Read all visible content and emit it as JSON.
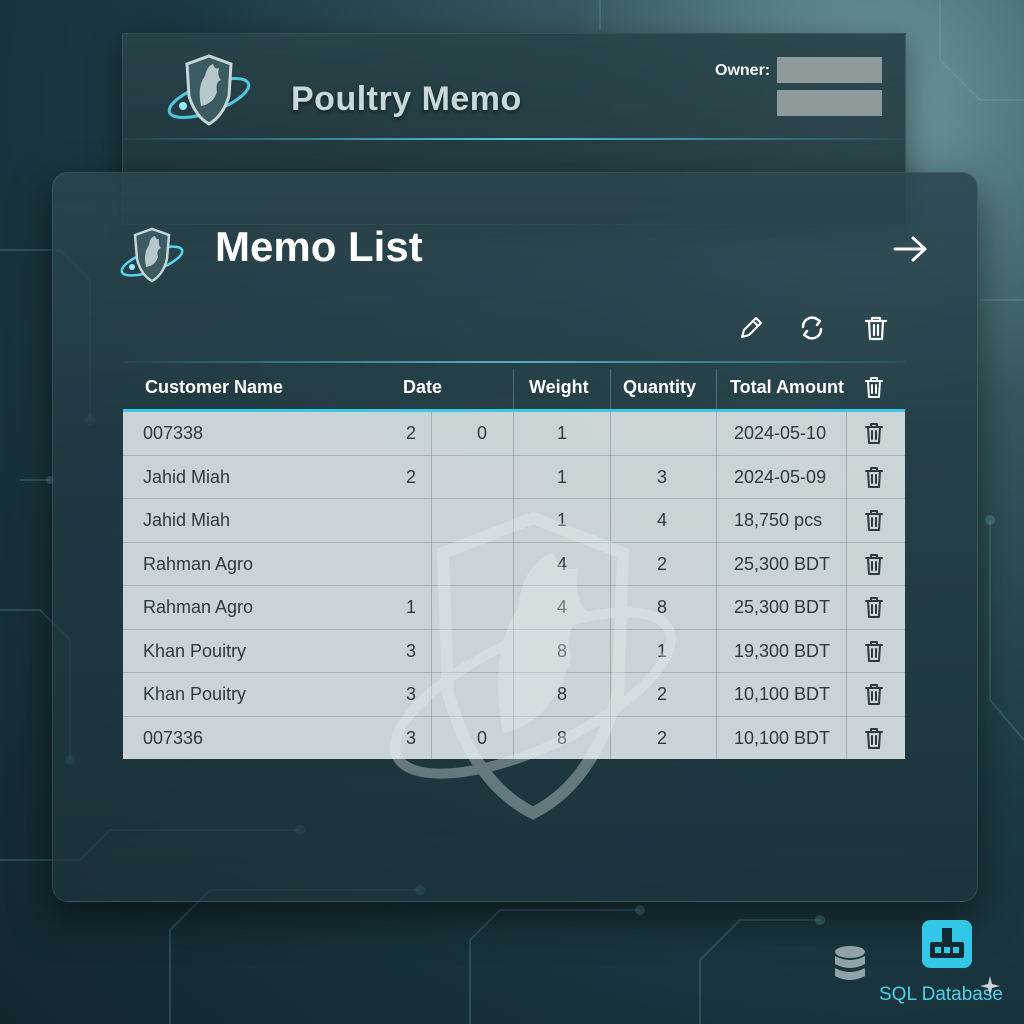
{
  "header": {
    "app_title": "Poultry Memo",
    "owner_label": "Owner:"
  },
  "main": {
    "title": "Memo List",
    "columns": [
      "Customer Name",
      "Date",
      "Weight",
      "Quantity",
      "Total Amount"
    ],
    "rows": [
      {
        "customer": "007338",
        "c1": "2",
        "c2": "0",
        "c3": "1",
        "c4": "",
        "amount": "2024-05-10"
      },
      {
        "customer": "Jahid Miah",
        "c1": "2",
        "c2": "",
        "c3": "1",
        "c4": "3",
        "amount": "2024-05-09"
      },
      {
        "customer": "Jahid Miah",
        "c1": "",
        "c2": "",
        "c3": "1",
        "c4": "4",
        "amount": "18,750 pcs"
      },
      {
        "customer": "Rahman Agro",
        "c1": "",
        "c2": "",
        "c3": "4",
        "c4": "2",
        "amount": "25,300 BDT"
      },
      {
        "customer": "Rahman Agro",
        "c1": "1",
        "c2": "",
        "c3": "4",
        "c4": "8",
        "amount": "25,300 BDT"
      },
      {
        "customer": "Khan Pouitry",
        "c1": "3",
        "c2": "",
        "c3": "8",
        "c4": "1",
        "amount": "19,300 BDT"
      },
      {
        "customer": "Khan Pouitry",
        "c1": "3",
        "c2": "",
        "c3": "8",
        "c4": "2",
        "amount": "10,100 BDT"
      },
      {
        "customer": "007336",
        "c1": "3",
        "c2": "0",
        "c3": "8",
        "c4": "2",
        "amount": "10,100 BDT"
      }
    ]
  },
  "footer": {
    "sql_label": "SQL Database"
  },
  "icons": {
    "edit": "pencil-icon",
    "refresh": "refresh-icon",
    "delete": "trash-icon",
    "next": "arrow-right-icon",
    "database": "database-icon",
    "sql": "sql-database-icon"
  },
  "colors": {
    "accent": "#3ec6e6",
    "table_bg": "#d7e2e4",
    "panel": "#2c464e"
  }
}
